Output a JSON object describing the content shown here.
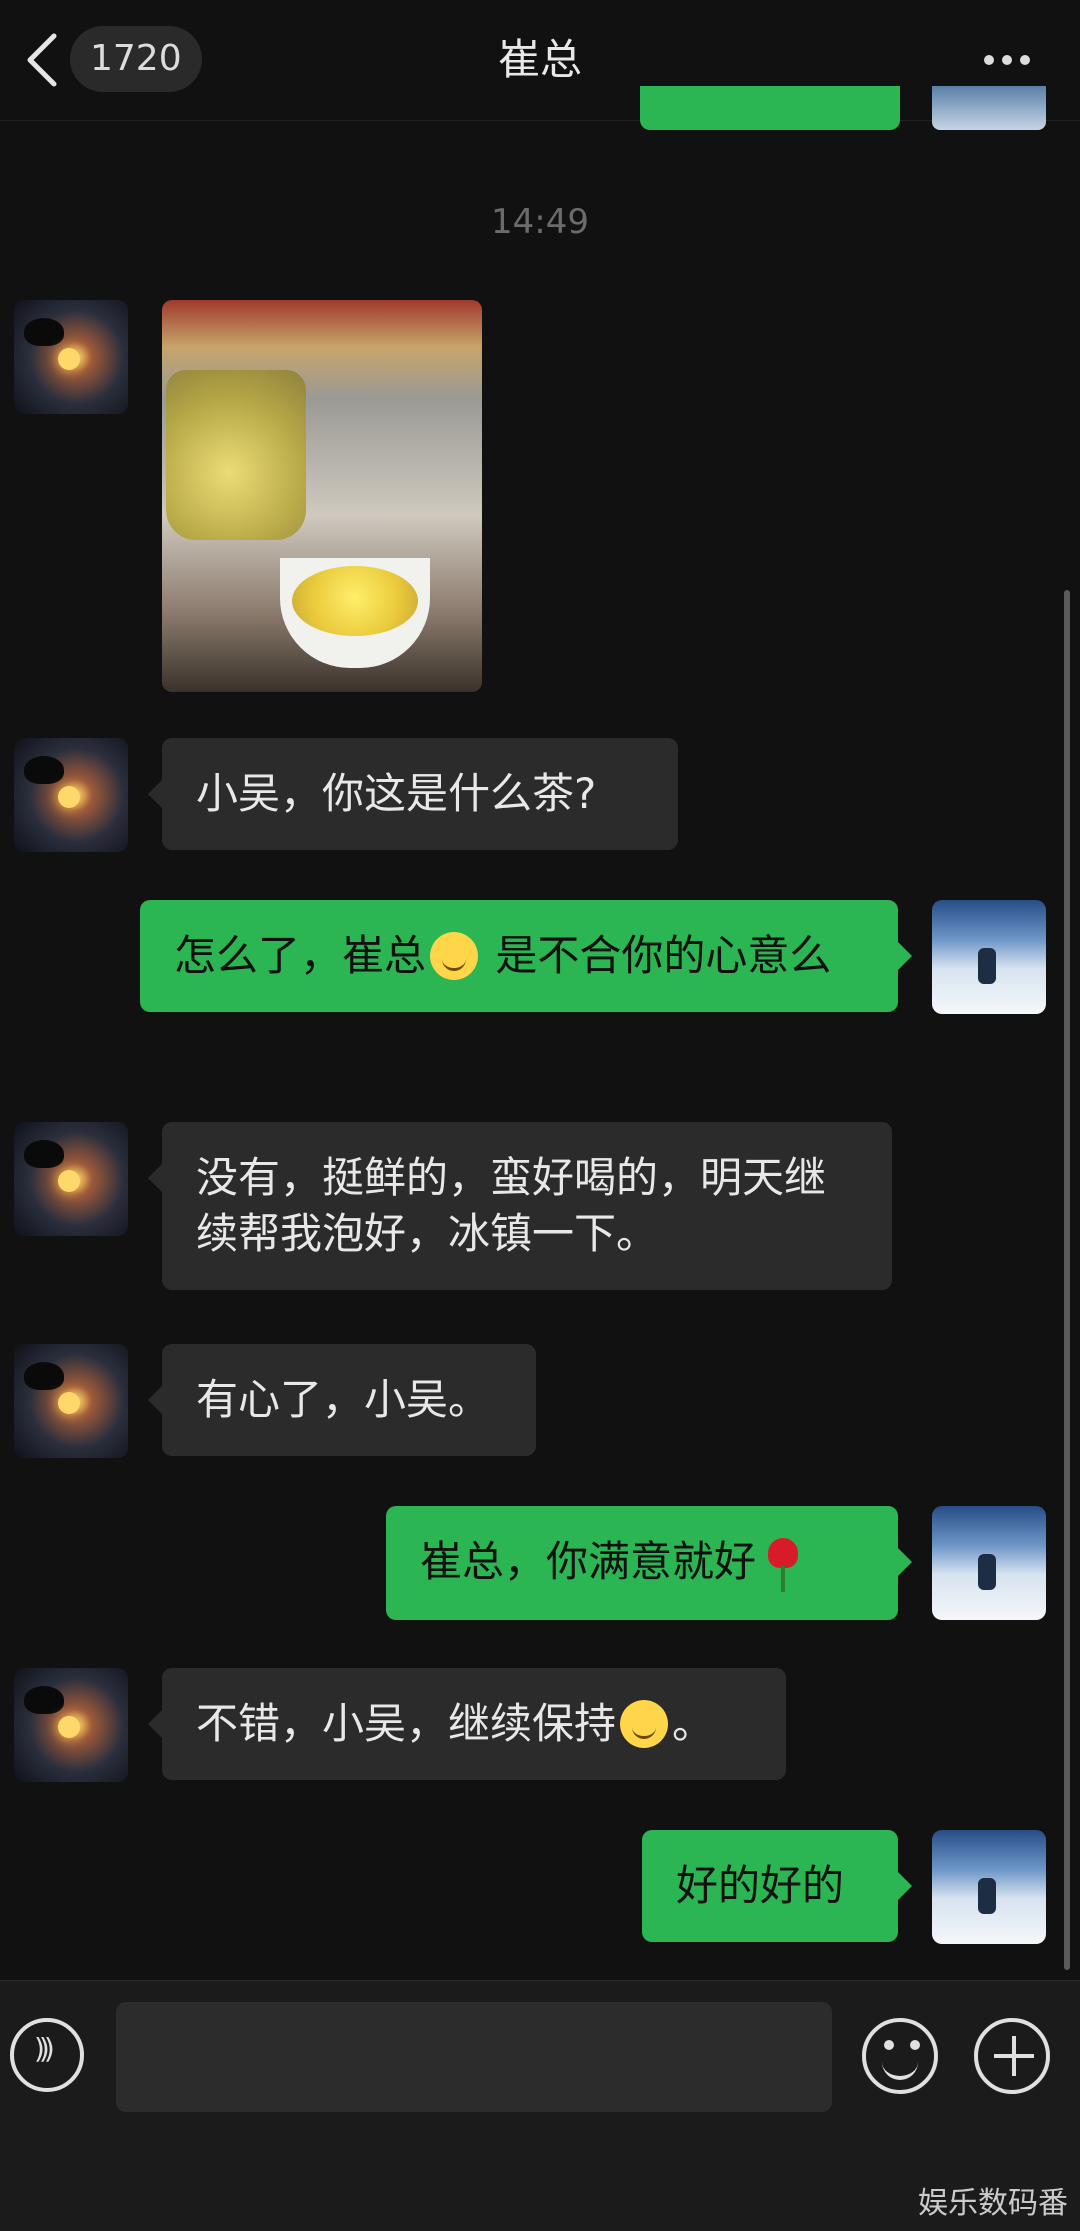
{
  "header": {
    "back_icon": "chevron-left-icon",
    "unread_count": "1720",
    "title": "崔总",
    "more_icon": "more-horizontal-icon"
  },
  "time_divider": "14:49",
  "messages": [
    {
      "side": "left",
      "type": "image",
      "image": "tea-photo"
    },
    {
      "side": "left",
      "type": "text",
      "text": "小吴，你这是什么茶?"
    },
    {
      "side": "right",
      "type": "text",
      "text_before": "怎么了，崔总",
      "emoji": "smiling-face",
      "text_after": " 是不合你的心意么"
    },
    {
      "side": "left",
      "type": "text",
      "text": "没有，挺鲜的，蛮好喝的，明天继续帮我泡好，冰镇一下。"
    },
    {
      "side": "left",
      "type": "text",
      "text": "有心了，小吴。"
    },
    {
      "side": "right",
      "type": "text",
      "text": "崔总，你满意就好",
      "emoji": "rose"
    },
    {
      "side": "left",
      "type": "text",
      "text_before": "不错，小吴，继续保持",
      "emoji": "smiling-face",
      "text_after": "。"
    },
    {
      "side": "right",
      "type": "text",
      "text": "好的好的"
    }
  ],
  "input_bar": {
    "voice_icon": "voice-icon",
    "input_value": "",
    "emoji_icon": "emoji-icon",
    "plus_icon": "plus-icon"
  },
  "watermark": "娱乐数码番",
  "colors": {
    "background": "#111111",
    "incoming_bubble": "#2b2b2b",
    "outgoing_bubble": "#2bb553"
  }
}
